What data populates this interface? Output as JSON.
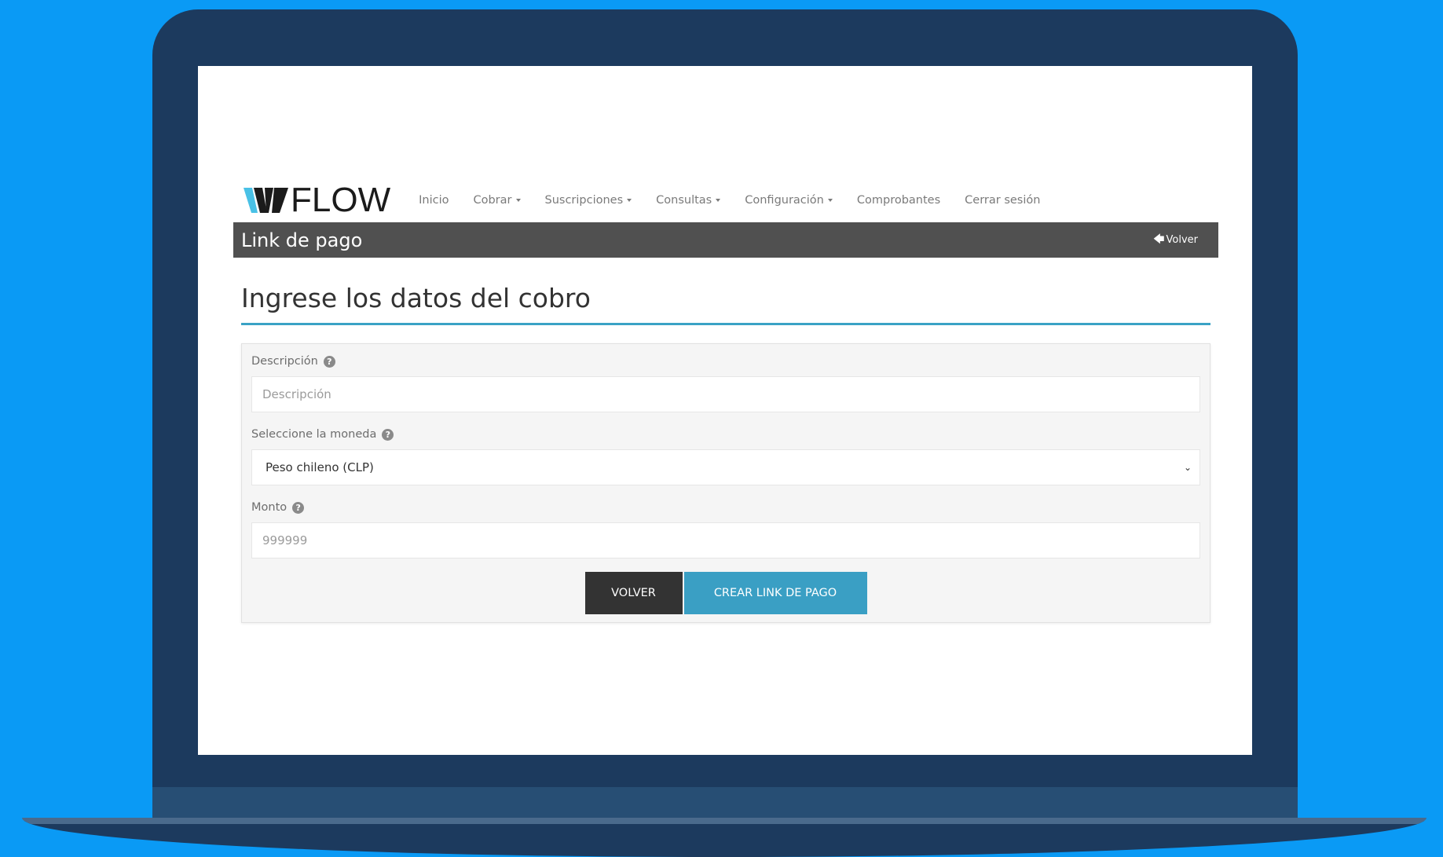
{
  "brand": {
    "name": "FLOW",
    "colors": {
      "background": "#0a9af5",
      "device": "#1c3a5e",
      "accent": "#3a9fc4",
      "titlebar": "#505050",
      "dark_button": "#333333"
    }
  },
  "nav": {
    "items": [
      {
        "label": "Inicio",
        "dropdown": false
      },
      {
        "label": "Cobrar",
        "dropdown": true
      },
      {
        "label": "Suscripciones",
        "dropdown": true
      },
      {
        "label": "Consultas",
        "dropdown": true
      },
      {
        "label": "Configuración",
        "dropdown": true
      },
      {
        "label": "Comprobantes",
        "dropdown": false
      },
      {
        "label": "Cerrar sesión",
        "dropdown": false
      }
    ]
  },
  "titlebar": {
    "title": "Link de pago",
    "back_label": "Volver",
    "back_icon": "arrow-left-icon"
  },
  "section": {
    "heading": "Ingrese los datos del cobro"
  },
  "form": {
    "description": {
      "label": "Descripción",
      "placeholder": "Descripción",
      "help_icon": "question-circle-icon"
    },
    "currency": {
      "label": "Seleccione la moneda",
      "selected": "Peso chileno (CLP)",
      "help_icon": "question-circle-icon"
    },
    "amount": {
      "label": "Monto",
      "placeholder": "999999",
      "help_icon": "question-circle-icon"
    },
    "buttons": {
      "back": "VOLVER",
      "submit": "CREAR LINK DE PAGO"
    }
  }
}
